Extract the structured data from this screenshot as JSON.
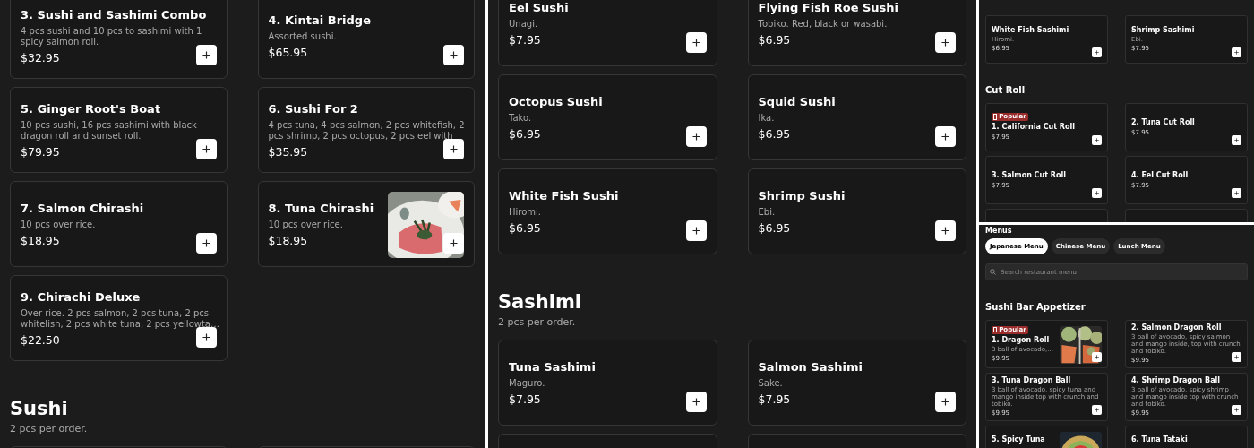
{
  "panels": [
    {
      "kind": "wide",
      "blocks": [
        {
          "kind": "cards",
          "items": [
            {
              "name": "3. Sushi and Sashimi Combo",
              "description": "4 pcs sushi and 10 pcs to sashimi with 1 spicy salmon roll.",
              "price": "$32.95"
            },
            {
              "name": "4. Kintai Bridge",
              "description": "Assorted sushi.",
              "price": "$65.95"
            },
            {
              "name": "5. Ginger Root's Boat",
              "description": "10 pcs sushi, 16 pcs sashimi with black dragon roll and sunset roll.",
              "price": "$79.95"
            },
            {
              "name": "6. Sushi For 2",
              "description": "4 pcs tuna, 4 pcs salmon, 2 pcs whitefish, 2 pcs shrimp, 2 pcs octopus, 2 pcs eel with",
              "price": "$35.95"
            },
            {
              "name": "7. Salmon Chirashi",
              "description": "10 pcs over rice.",
              "price": "$18.95"
            },
            {
              "name": "8. Tuna Chirashi",
              "description": "10 pcs over rice.",
              "price": "$18.95",
              "image": true
            },
            {
              "name": "9. Chirachi Deluxe",
              "description": "Over rice. 2 pcs salmon, 2 pcs tuna, 2 pcs whitelish, 2 pcs white tuna, 2 pcs yellowta…",
              "price": "$22.50"
            }
          ]
        },
        {
          "kind": "section",
          "title": "Sushi",
          "subtitle": "2 pcs per order."
        }
      ]
    },
    {
      "kind": "wide",
      "blocks": [
        {
          "kind": "cards",
          "items": [
            {
              "name": "Eel Sushi",
              "description": "Unagi.",
              "price": "$7.95"
            },
            {
              "name": "Flying Fish Roe Sushi",
              "description": "Tobiko. Red, black or wasabi.",
              "price": "$6.95"
            },
            {
              "name": "Octopus Sushi",
              "description": "Tako.",
              "price": "$6.95"
            },
            {
              "name": "Squid Sushi",
              "description": "Ika.",
              "price": "$6.95"
            },
            {
              "name": "White Fish Sushi",
              "description": "Hiromi.",
              "price": "$6.95"
            },
            {
              "name": "Shrimp Sushi",
              "description": "Ebi.",
              "price": "$6.95"
            }
          ]
        },
        {
          "kind": "section",
          "title": "Sashimi",
          "subtitle": "2 pcs per order."
        },
        {
          "kind": "cards",
          "items": [
            {
              "name": "Tuna Sashimi",
              "description": "Maguro.",
              "price": "$7.95"
            },
            {
              "name": "Salmon Sashimi",
              "description": "Sake.",
              "price": "$7.95"
            }
          ]
        }
      ]
    },
    {
      "kind": "compact",
      "blocks": [
        {
          "kind": "cards",
          "items": [
            {
              "name": "White Fish Sashimi",
              "description": "Hiromi.",
              "price": "$6.95"
            },
            {
              "name": "Shrimp Sashimi",
              "description": "Ebi.",
              "price": "$7.95"
            }
          ]
        },
        {
          "kind": "section",
          "title": "Cut Roll"
        },
        {
          "kind": "cards",
          "items": [
            {
              "name": "1. California Cut Roll",
              "badge": "Popular",
              "price": "$7.95"
            },
            {
              "name": "2. Tuna Cut Roll",
              "price": "$7.95"
            },
            {
              "name": "3. Salmon Cut Roll",
              "price": "$7.95"
            },
            {
              "name": "4. Eel Cut Roll",
              "price": "$7.95"
            }
          ]
        }
      ]
    },
    {
      "kind": "compact",
      "blocks": [
        {
          "kind": "menu_header",
          "title": "Menus",
          "tabs": [
            {
              "label": "Japanese Menu",
              "selected": true
            },
            {
              "label": "Chinese Menu",
              "selected": false
            },
            {
              "label": "Lunch Menu",
              "selected": false
            }
          ],
          "search_placeholder": "Search restaurant menu"
        },
        {
          "kind": "section",
          "title": "Sushi Bar Appetizer"
        },
        {
          "kind": "cards",
          "items": [
            {
              "name": "1. Dragon Roll",
              "badge": "Popular",
              "description": "3 ball of avocado,...",
              "price": "$9.95",
              "image": true
            },
            {
              "name": "2. Salmon Dragon Roll",
              "description": "3 ball of avocado, spicy salmon and mango inside, top with crunch and tobiko.",
              "price": "$9.95"
            },
            {
              "name": "3. Tuna Dragon Ball",
              "description": "3 ball of avocado, spicy tuna and mango inside top with crunch and tobiko.",
              "price": "$9.95"
            },
            {
              "name": "4. Shrimp Dragon Ball",
              "description": "3 ball of avocado, spicy shrimp and mango inside top with crunch and tobiko.",
              "price": "$9.95"
            },
            {
              "name": "5. Spicy Tuna",
              "image": true
            },
            {
              "name": "6. Tuna Tataki"
            }
          ]
        }
      ]
    }
  ]
}
